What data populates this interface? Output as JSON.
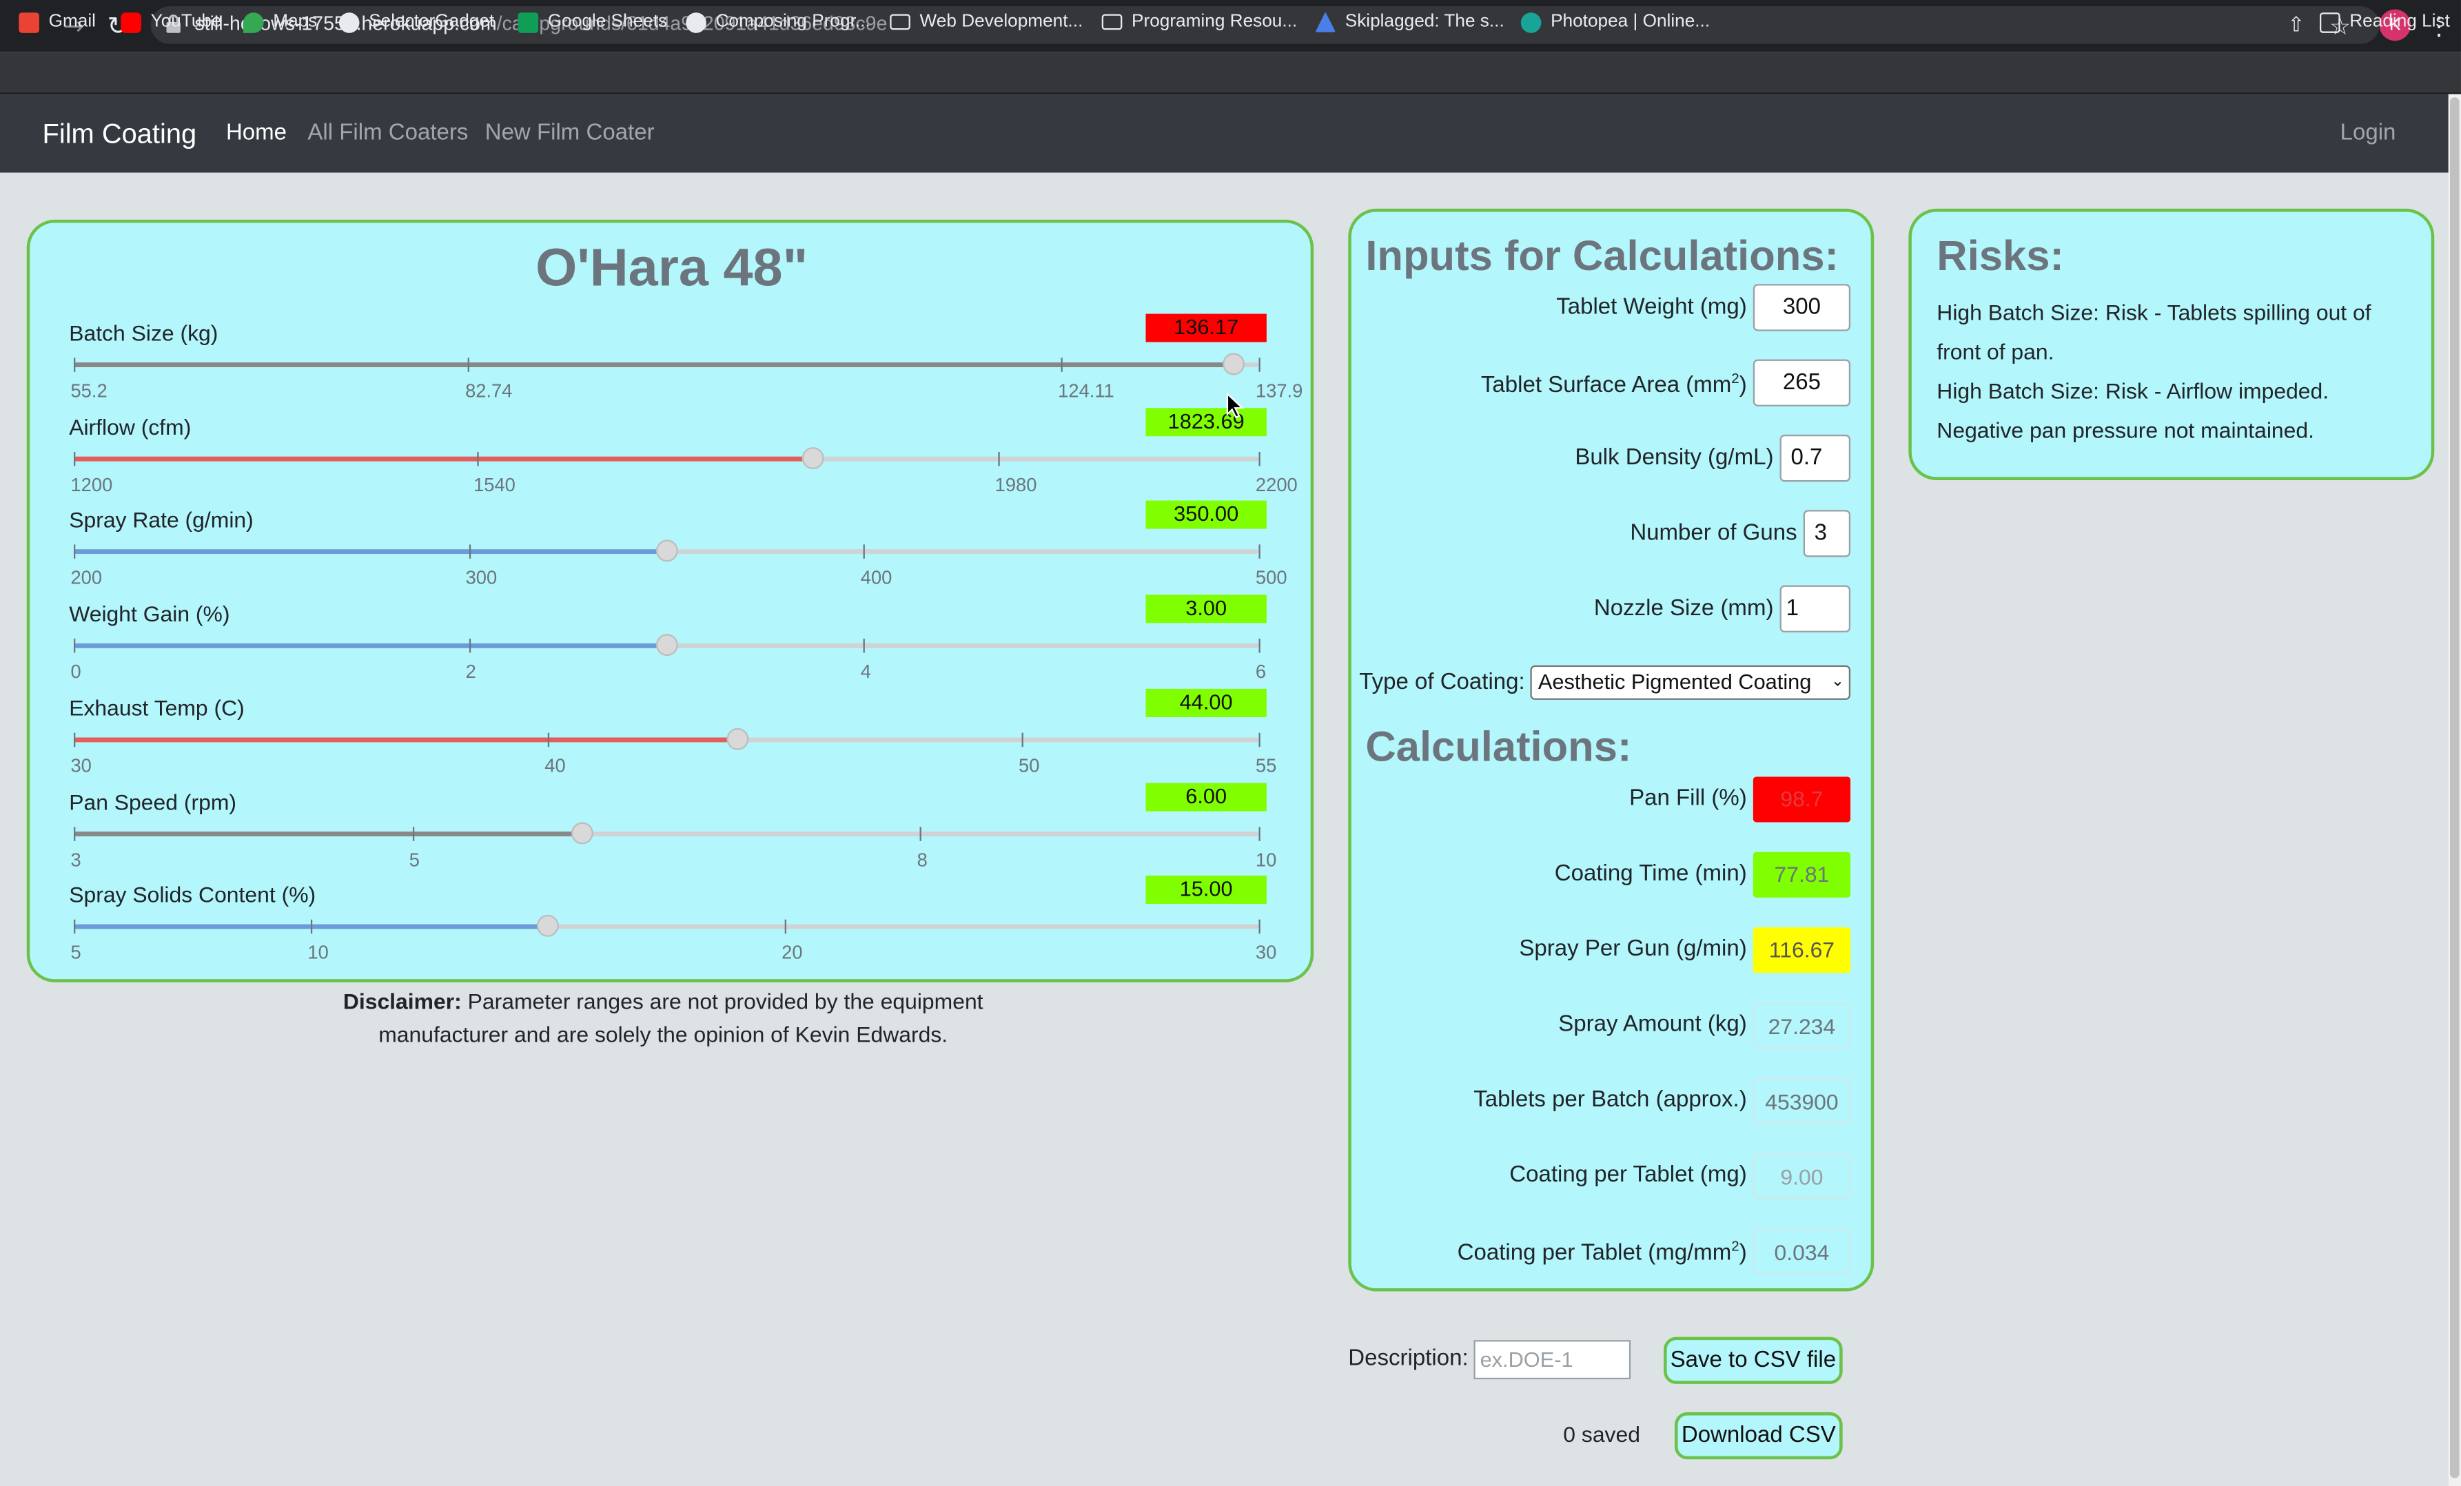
{
  "browser": {
    "url_host": "still-hollows-17551.herokuapp.com",
    "url_path": "/campgrounds/61d4a932091a41d36ed93c9e",
    "profile_initial": "K",
    "bookmarks": [
      "Gmail",
      "YouTube",
      "Maps",
      "SelectorGadget",
      "Google Sheets",
      "Composing Progr...",
      "Web Development...",
      "Programing Resou...",
      "Skiplagged: The s...",
      "Photopea | Online..."
    ],
    "reading_list": "Reading List"
  },
  "nav": {
    "brand": "Film Coating",
    "home": "Home",
    "all": "All Film Coaters",
    "new": "New Film Coater",
    "login": "Login"
  },
  "coater": {
    "title": "O'Hara 48\"",
    "sliders": [
      {
        "label": "Batch Size (kg)",
        "value": "136.17",
        "status_color": "#ff0000",
        "min": 55.2,
        "max": 137.9,
        "current": 136.17,
        "fill_color": "#888888",
        "ticks": [
          "55.2",
          "82.74",
          "124.11",
          "137.9"
        ],
        "tick_vals": [
          55.2,
          82.74,
          124.11,
          137.9
        ]
      },
      {
        "label": "Airflow (cfm)",
        "value": "1823.69",
        "status_color": "#7fff00",
        "min": 1200,
        "max": 2200,
        "current": 1823.69,
        "fill_color": "#e35d5d",
        "ticks": [
          "1200",
          "1540",
          "1980",
          "2200"
        ],
        "tick_vals": [
          1200,
          1540,
          1980,
          2200
        ]
      },
      {
        "label": "Spray Rate (g/min)",
        "value": "350.00",
        "status_color": "#7fff00",
        "min": 200,
        "max": 500,
        "current": 350,
        "fill_color": "#6b9bd8",
        "ticks": [
          "200",
          "300",
          "400",
          "500"
        ],
        "tick_vals": [
          200,
          300,
          400,
          500
        ]
      },
      {
        "label": "Weight Gain (%)",
        "value": "3.00",
        "status_color": "#7fff00",
        "min": 0,
        "max": 6,
        "current": 3,
        "fill_color": "#6b9bd8",
        "ticks": [
          "0",
          "2",
          "4",
          "6"
        ],
        "tick_vals": [
          0,
          2,
          4,
          6
        ]
      },
      {
        "label": "Exhaust Temp (C)",
        "value": "44.00",
        "status_color": "#7fff00",
        "min": 30,
        "max": 55,
        "current": 44,
        "fill_color": "#e35d5d",
        "ticks": [
          "30",
          "40",
          "50",
          "55"
        ],
        "tick_vals": [
          30,
          40,
          50,
          55
        ]
      },
      {
        "label": "Pan Speed (rpm)",
        "value": "6.00",
        "status_color": "#7fff00",
        "min": 3,
        "max": 10,
        "current": 6,
        "fill_color": "#888888",
        "ticks": [
          "3",
          "5",
          "8",
          "10"
        ],
        "tick_vals": [
          3,
          5,
          8,
          10
        ]
      },
      {
        "label": "Spray Solids Content (%)",
        "value": "15.00",
        "status_color": "#7fff00",
        "min": 5,
        "max": 30,
        "current": 15,
        "fill_color": "#6b9bd8",
        "ticks": [
          "5",
          "10",
          "20",
          "30"
        ],
        "tick_vals": [
          5,
          10,
          20,
          30
        ]
      }
    ],
    "disclaimer_bold": "Disclaimer:",
    "disclaimer_text": " Parameter ranges are not provided by the equipment manufacturer and are solely the opinion of Kevin Edwards."
  },
  "inputs": {
    "heading": "Inputs for Calculations:",
    "tablet_weight_label": "Tablet Weight (mg)",
    "tablet_weight": "300",
    "surface_area_label": "Tablet Surface Area (mm",
    "surface_area_sup": "2",
    "surface_area_close": ")",
    "surface_area": "265",
    "bulk_density_label": "Bulk Density (g/mL)",
    "bulk_density": "0.7",
    "guns_label": "Number of Guns",
    "guns": "3",
    "nozzle_label": "Nozzle Size (mm)",
    "nozzle": "1",
    "coating_type_label": "Type of Coating:",
    "coating_type": "Aesthetic Pigmented Coating"
  },
  "calculations": {
    "heading": "Calculations:",
    "pan_fill_label": "Pan Fill (%)",
    "pan_fill": "98.7",
    "pan_fill_color": "#ff0000",
    "coating_time_label": "Coating Time (min)",
    "coating_time": "77.81",
    "coating_time_color": "#7fff00",
    "spray_per_gun_label": "Spray Per Gun (g/min)",
    "spray_per_gun": "116.67",
    "spray_per_gun_color": "#ffff00",
    "spray_amount_label": "Spray Amount (kg)",
    "spray_amount": "27.234",
    "tablets_label": "Tablets per Batch (approx.)",
    "tablets": "453900",
    "coating_mg_label": "Coating per Tablet (mg)",
    "coating_mg": "9.00",
    "coating_mm2_label": "Coating per Tablet (mg/mm",
    "coating_mm2_sup": "2",
    "coating_mm2_close": ")",
    "coating_mm2": "0.034"
  },
  "risks": {
    "heading": "Risks:",
    "lines": [
      "High Batch Size: Risk - Tablets spilling out of",
      "front of pan.",
      "High Batch Size: Risk - Airflow impeded.",
      "Negative pan pressure not maintained."
    ]
  },
  "footer": {
    "description_label": "Description:",
    "description_placeholder": "ex.DOE-1",
    "save_button": "Save to CSV file",
    "saved_count": "0 saved",
    "download_button": "Download CSV"
  }
}
